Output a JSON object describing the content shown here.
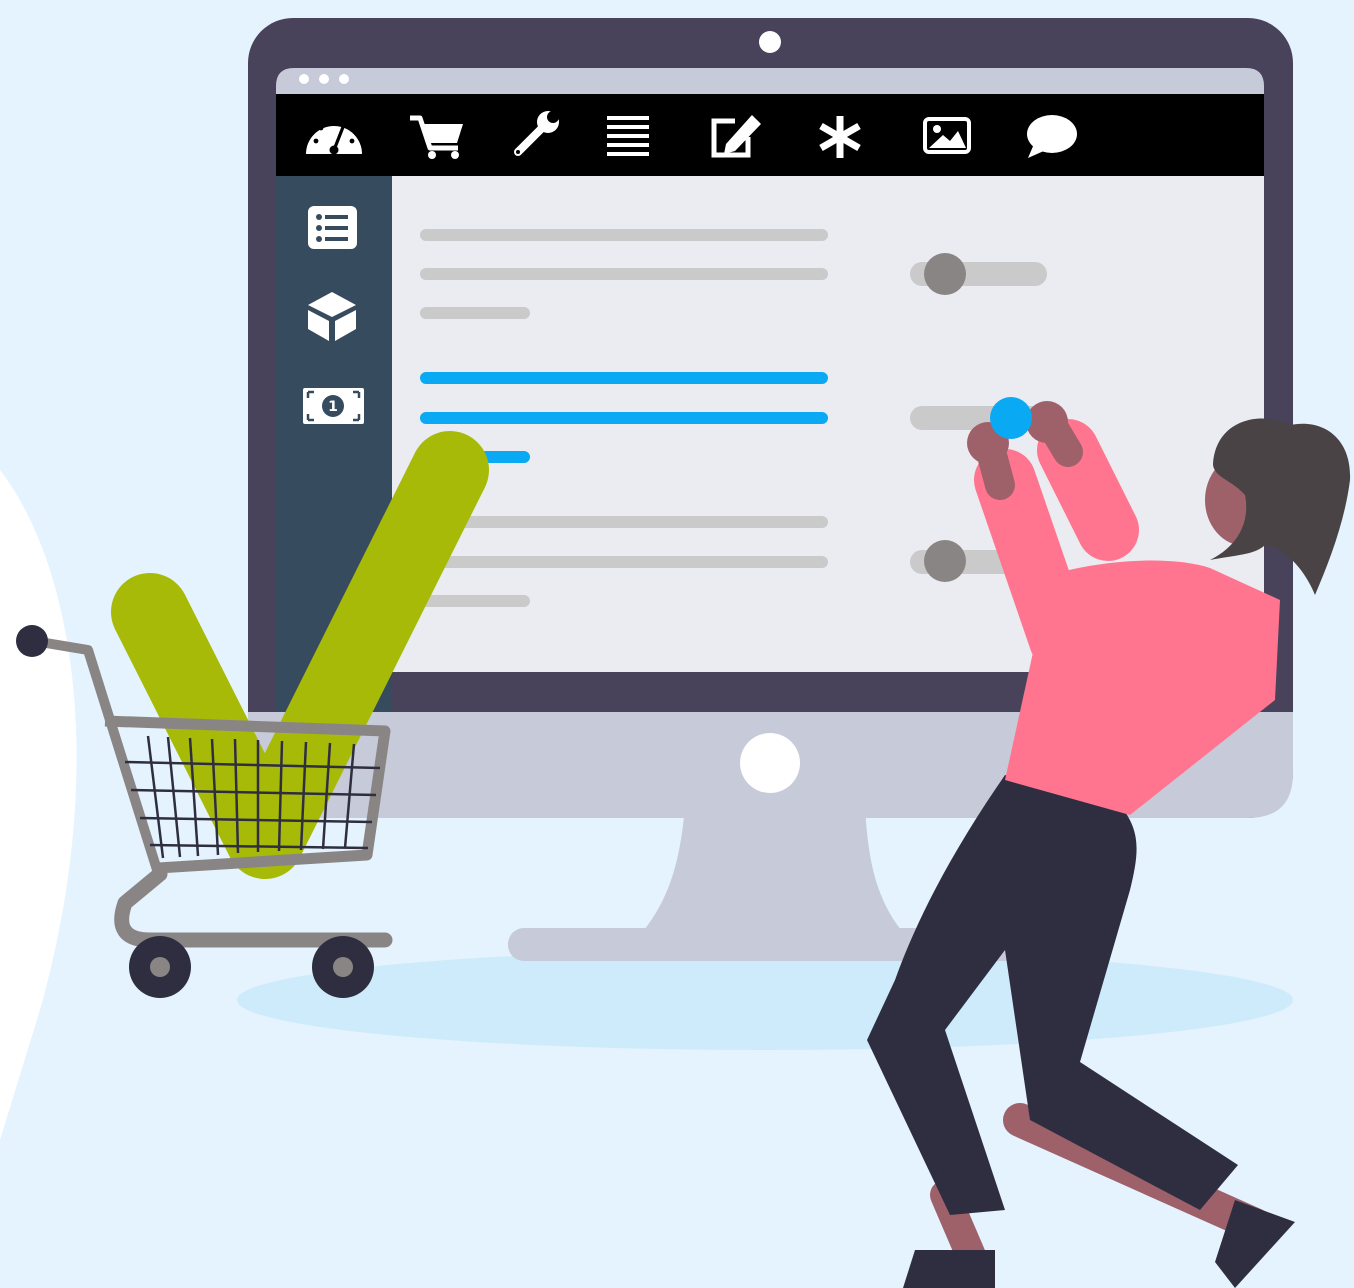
{
  "colors": {
    "background": "#e4f3fd",
    "monitor_frame": "#48425a",
    "monitor_stand": "#c7cbd9",
    "toolbar": "#000000",
    "sidebar": "#374b5f",
    "screen": "#eaecf1",
    "placeholder_gray": "#cacaca",
    "accent_blue": "#0aa9f4",
    "toggle_knob": "#8a8585",
    "checkmark_green": "#a8ba08",
    "shirt_pink": "#ff7590",
    "pants_navy": "#2f2e41",
    "skin": "#9e616a",
    "hair": "#4a4345"
  },
  "toolbar": {
    "icons": [
      "dashboard-icon",
      "cart-icon",
      "wrench-icon",
      "align-justify-icon",
      "edit-icon",
      "asterisk-icon",
      "image-icon",
      "comment-icon"
    ]
  },
  "sidebar": {
    "icons": [
      "list-icon",
      "box-icon",
      "money-bill-icon"
    ],
    "money_label": "1"
  },
  "settings": {
    "rows": [
      {
        "state": "off",
        "highlighted": false
      },
      {
        "state": "on",
        "highlighted": true
      },
      {
        "state": "off",
        "highlighted": false
      }
    ]
  }
}
